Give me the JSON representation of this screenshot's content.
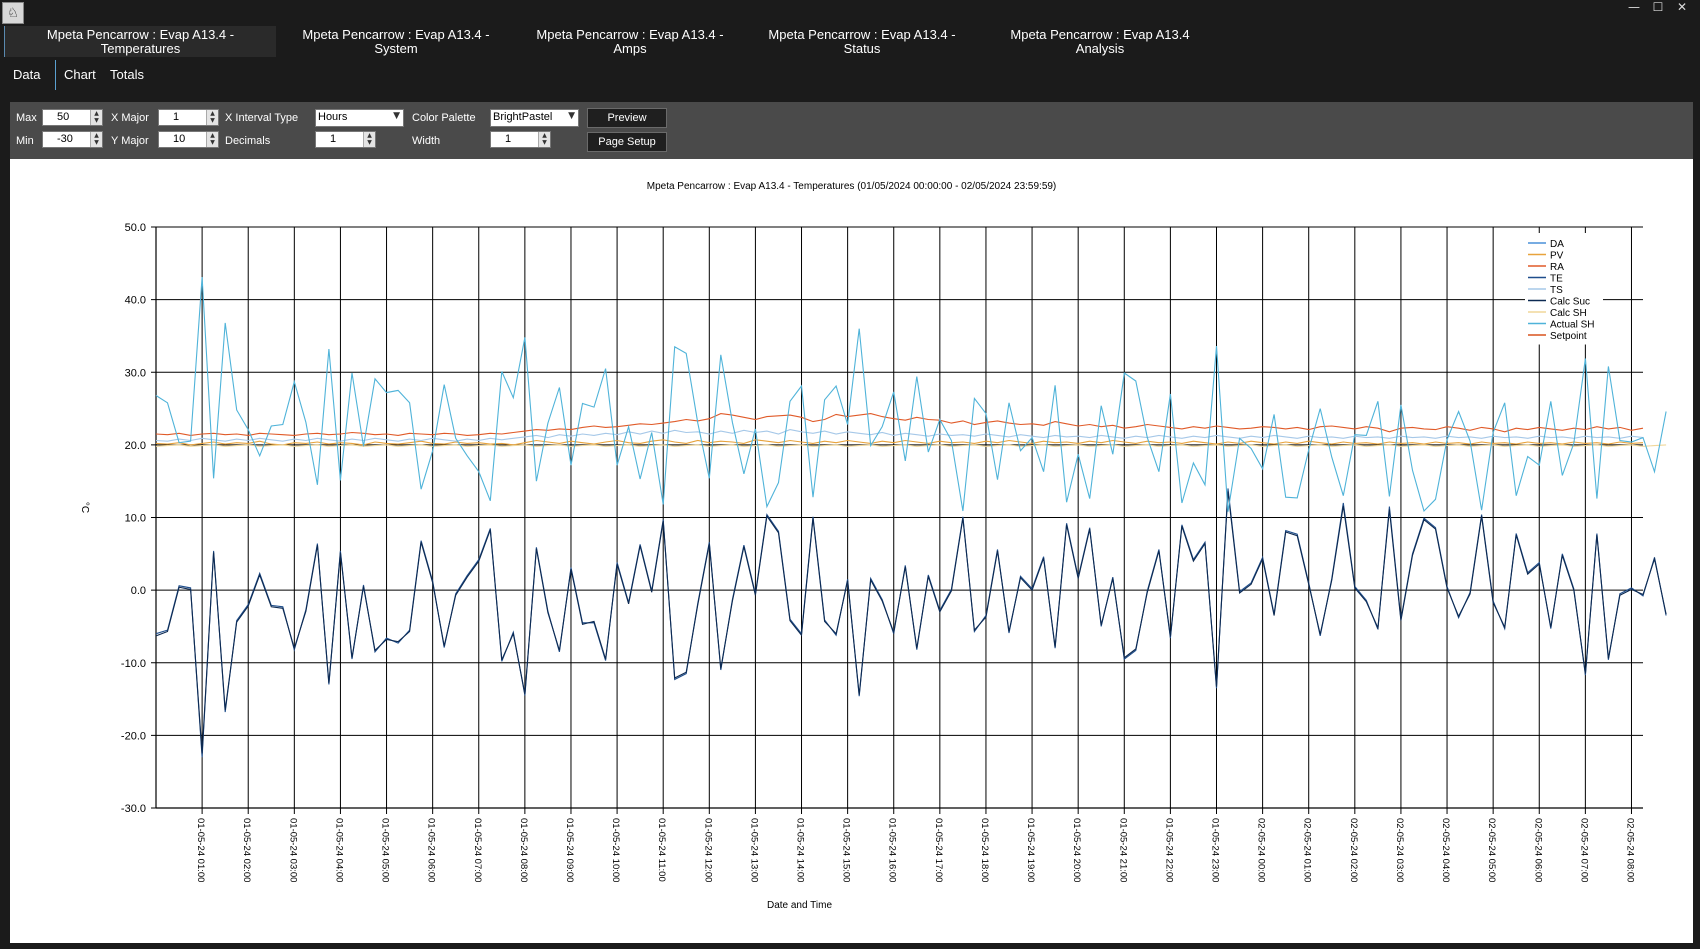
{
  "app": {
    "icon": "app-logo-icon"
  },
  "window_controls": {
    "minimize": "—",
    "maximize": "☐",
    "close": "✕"
  },
  "tabs": [
    {
      "line1": "Mpeta Pencarrow : Evap A13.4 -",
      "line2": "Temperatures",
      "active": true
    },
    {
      "line1": "Mpeta Pencarrow : Evap A13.4 -",
      "line2": "System",
      "active": false
    },
    {
      "line1": "Mpeta Pencarrow : Evap A13.4 -",
      "line2": "Amps",
      "active": false
    },
    {
      "line1": "Mpeta Pencarrow : Evap A13.4 -",
      "line2": "Status",
      "active": false
    },
    {
      "line1": "Mpeta Pencarrow : Evap A13.4",
      "line2": "Analysis",
      "active": false
    }
  ],
  "subtabs": [
    "Data",
    "Chart",
    "Totals"
  ],
  "toolbar": {
    "max_label": "Max",
    "max_value": "50",
    "min_label": "Min",
    "min_value": "-30",
    "xmajor_label": "X Major",
    "xmajor_value": "1",
    "ymajor_label": "Y Major",
    "ymajor_value": "10",
    "xinterval_label": "X Interval Type",
    "xinterval_value": "Hours",
    "decimals_label": "Decimals",
    "decimals_value": "1",
    "palette_label": "Color Palette",
    "palette_value": "BrightPastel",
    "width_label": "Width",
    "width_value": "1",
    "preview_label": "Preview",
    "pagesetup_label": "Page Setup"
  },
  "chart_data": {
    "type": "line",
    "title": "Mpeta Pencarrow : Evap A13.4 - Temperatures (01/05/2024 00:00:00 - 02/05/2024 23:59:59)",
    "xlabel": "Date and Time",
    "ylabel": "°C",
    "ylim": [
      -30,
      50
    ],
    "yticks": [
      "50.0",
      "40.0",
      "30.0",
      "20.0",
      "10.0",
      "0.0",
      "-10.0",
      "-20.0",
      "-30.0"
    ],
    "xlim": [
      0,
      32.25
    ],
    "x_tick_positions": [
      1,
      2,
      3,
      4,
      5,
      6,
      7,
      8,
      9,
      10,
      11,
      12,
      13,
      14,
      15,
      16,
      17,
      18,
      19,
      20,
      21,
      22,
      23,
      24,
      25,
      26,
      27,
      28,
      29,
      30,
      31,
      32
    ],
    "x_tick_labels": [
      "01-05-24 01:00",
      "01-05-24 02:00",
      "01-05-24 03:00",
      "01-05-24 04:00",
      "01-05-24 05:00",
      "01-05-24 06:00",
      "01-05-24 07:00",
      "01-05-24 08:00",
      "01-05-24 09:00",
      "01-05-24 10:00",
      "01-05-24 11:00",
      "01-05-24 12:00",
      "01-05-24 13:00",
      "01-05-24 14:00",
      "01-05-24 15:00",
      "01-05-24 16:00",
      "01-05-24 17:00",
      "01-05-24 18:00",
      "01-05-24 19:00",
      "01-05-24 20:00",
      "01-05-24 21:00",
      "01-05-24 22:00",
      "01-05-24 23:00",
      "02-05-24 00:00",
      "02-05-24 01:00",
      "02-05-24 02:00",
      "02-05-24 03:00",
      "02-05-24 04:00",
      "02-05-24 05:00",
      "02-05-24 06:00",
      "02-05-24 07:00",
      "02-05-24 08:00"
    ],
    "grid": true,
    "legend_position": "top-right",
    "sample_step": 0.25,
    "series": [
      {
        "name": "DA",
        "color": "#4a90d9",
        "values": []
      },
      {
        "name": "PV",
        "color": "#e8a33c",
        "values": [
          20.2,
          20.1,
          20.3,
          20.0,
          20.2,
          20.4,
          20.1,
          20.3,
          20.2,
          20.5,
          20.1,
          20.0,
          20.3,
          20.2,
          20.4,
          20.1,
          20.3,
          20.2,
          20.0,
          20.4,
          20.2,
          20.1,
          20.3,
          20.5,
          20.2,
          20.1,
          20.4,
          20.2,
          20.3,
          20.1,
          20.2,
          20.0,
          20.3,
          20.6,
          20.4,
          20.2,
          20.5,
          20.3,
          20.1,
          20.4,
          20.6,
          20.3,
          20.2,
          20.5,
          20.7,
          20.4,
          20.2,
          20.6,
          20.3,
          20.5,
          20.4,
          20.2,
          20.7,
          20.5,
          20.3,
          20.6,
          20.4,
          20.2,
          20.5,
          20.3,
          20.6,
          20.4,
          20.2,
          20.5,
          20.3,
          20.6,
          20.4,
          20.2,
          20.5,
          20.3,
          20.4,
          20.2,
          20.5,
          20.3,
          20.6,
          20.4,
          20.2,
          20.5,
          20.3,
          20.4,
          20.2,
          20.5,
          20.3,
          20.6,
          20.4,
          20.2,
          20.5,
          20.3,
          20.4,
          20.2,
          20.5,
          20.3,
          20.1,
          20.4,
          20.2,
          20.5,
          20.3,
          20.1,
          20.4,
          20.2,
          20.5,
          20.3,
          20.1,
          20.4,
          20.2,
          20.3,
          20.1,
          20.4,
          20.2,
          20.3,
          20.1,
          20.4,
          20.2,
          20.3,
          20.1,
          20.4,
          20.2,
          20.3,
          20.1,
          20.4,
          20.2,
          20.3,
          20.1,
          20.4,
          20.2,
          20.3,
          20.1,
          20.4,
          20.2,
          20.3
        ]
      },
      {
        "name": "RA",
        "color": "#e05a28",
        "values": [
          21.5,
          21.4,
          21.6,
          21.3,
          21.5,
          21.6,
          21.4,
          21.5,
          21.3,
          21.6,
          21.5,
          21.4,
          21.3,
          21.5,
          21.6,
          21.4,
          21.5,
          21.7,
          21.6,
          21.4,
          21.5,
          21.3,
          21.6,
          21.5,
          21.4,
          21.6,
          21.5,
          21.3,
          21.4,
          21.6,
          21.5,
          21.7,
          21.9,
          22.1,
          22.0,
          22.2,
          22.1,
          22.4,
          22.6,
          22.4,
          22.5,
          22.7,
          22.9,
          22.8,
          23.0,
          23.2,
          23.5,
          23.3,
          23.6,
          24.3,
          24.1,
          23.8,
          23.5,
          23.9,
          24.0,
          24.1,
          23.8,
          23.2,
          23.5,
          24.2,
          23.9,
          24.1,
          24.3,
          23.9,
          23.6,
          23.4,
          23.8,
          23.5,
          23.4,
          23.0,
          23.3,
          22.8,
          23.1,
          23.3,
          23.0,
          22.8,
          22.9,
          22.7,
          23.2,
          22.9,
          22.6,
          22.8,
          22.5,
          22.7,
          22.3,
          22.5,
          22.8,
          22.6,
          22.4,
          22.2,
          22.5,
          22.3,
          22.6,
          22.4,
          22.2,
          22.3,
          22.5,
          22.4,
          22.2,
          22.4,
          22.1,
          22.5,
          22.6,
          22.4,
          22.2,
          22.5,
          22.3,
          21.8,
          22.3,
          22.4,
          22.2,
          22.1,
          22.5,
          22.3,
          22.0,
          22.4,
          22.2,
          21.8,
          22.3,
          22.1,
          22.4,
          22.2,
          22.0,
          22.3,
          22.1,
          22.5,
          22.2,
          22.4,
          22.0,
          22.3
        ]
      },
      {
        "name": "TE",
        "color": "#1f4e8c",
        "values": [
          -6.0,
          -5.5,
          0.6,
          0.3,
          -23.0,
          5.4,
          -16.8,
          -4.2,
          -2.0,
          2.3,
          -2.1,
          -2.3,
          -8.2,
          -2.7,
          6.4,
          -13.0,
          5.4,
          -9.5,
          0.7,
          -8.5,
          -6.6,
          -7.3,
          -5.5,
          6.8,
          1.2,
          -7.9,
          -0.5,
          2.0,
          4.2,
          8.5,
          -9.8,
          -5.8,
          -14.5,
          5.9,
          -2.9,
          -8.5,
          3.1,
          -4.5,
          -4.5,
          -9.7,
          3.8,
          -1.7,
          6.3,
          -0.1,
          9.7,
          -12.3,
          -11.5,
          -1.8,
          6.6,
          -11.0,
          -1.3,
          6.2,
          -0.5,
          10.4,
          8.1,
          -4.0,
          -6.0,
          10.1,
          -4.1,
          -6.2,
          1.5,
          -14.6,
          1.6,
          -1.3,
          -6.0,
          3.4,
          -8.2,
          2.1,
          -2.8,
          0.1,
          10.1,
          -5.7,
          -3.5,
          5.6,
          -5.9,
          1.9,
          0.2,
          4.6,
          -8.0,
          9.2,
          1.8,
          8.6,
          -5.0,
          1.8,
          -9.5,
          -8.3,
          -0.1,
          5.6,
          -6.6,
          9.0,
          4.2,
          6.6,
          -13.5,
          14.0,
          -0.2,
          1.0,
          4.5,
          -3.3,
          8.2,
          7.7,
          1.0,
          -6.3,
          1.6,
          12.0,
          0.5,
          -1.4,
          -5.4,
          11.5,
          -4.0,
          5.0,
          9.9,
          8.6,
          0.5,
          -3.8,
          -0.3,
          10.4,
          -1.5,
          -5.3,
          7.8,
          2.4,
          3.8,
          -5.3,
          5.0,
          0.2,
          -11.7,
          7.8,
          -9.6,
          -0.5,
          0.3,
          -0.8,
          4.5,
          -3.5
        ]
      },
      {
        "name": "TS",
        "color": "#a6c8e8",
        "values": [
          20.6,
          20.5,
          20.8,
          20.6,
          20.9,
          20.7,
          20.5,
          20.8,
          20.6,
          20.9,
          20.7,
          20.5,
          20.8,
          20.6,
          20.9,
          20.7,
          20.5,
          20.8,
          20.6,
          20.9,
          20.7,
          20.5,
          20.8,
          20.6,
          20.9,
          20.7,
          20.5,
          20.8,
          20.6,
          20.9,
          20.7,
          20.9,
          21.1,
          21.3,
          21.0,
          21.4,
          21.2,
          21.5,
          21.3,
          21.6,
          21.4,
          21.8,
          21.5,
          21.9,
          21.6,
          22.0,
          21.7,
          21.8,
          21.5,
          21.9,
          21.6,
          22.0,
          21.7,
          21.9,
          21.5,
          22.1,
          21.8,
          21.6,
          21.9,
          21.5,
          21.8,
          21.6,
          21.4,
          21.7,
          21.3,
          21.6,
          21.4,
          21.2,
          21.5,
          21.3,
          21.4,
          21.2,
          21.5,
          21.3,
          21.1,
          21.4,
          21.2,
          21.0,
          21.3,
          21.1,
          21.2,
          21.0,
          21.3,
          21.1,
          20.9,
          21.2,
          21.0,
          21.3,
          21.1,
          20.9,
          21.2,
          21.0,
          21.3,
          21.1,
          20.9,
          21.2,
          21.0,
          21.3,
          21.1,
          20.9,
          21.2,
          21.0,
          21.1,
          20.9,
          21.2,
          21.0,
          21.1,
          20.9,
          21.2,
          21.0,
          21.1,
          20.9,
          21.2,
          21.0,
          21.1,
          20.9,
          21.2,
          21.0,
          21.1,
          20.9,
          21.2,
          21.0,
          21.1,
          20.9,
          21.2,
          21.0,
          21.1,
          20.9,
          21.2,
          21.0
        ]
      },
      {
        "name": "Calc Suc",
        "color": "#0d2a52",
        "values": [
          -6.3,
          -5.7,
          0.4,
          0.1,
          -22.5,
          5.2,
          -16.5,
          -4.4,
          -2.2,
          2.1,
          -2.3,
          -2.5,
          -8.0,
          -2.9,
          6.2,
          -12.8,
          5.2,
          -9.3,
          0.5,
          -8.3,
          -6.8,
          -7.1,
          -5.7,
          6.6,
          1.0,
          -7.7,
          -0.7,
          1.8,
          4.0,
          8.3,
          -9.6,
          -6.0,
          -14.3,
          5.7,
          -3.1,
          -8.3,
          2.9,
          -4.7,
          -4.3,
          -9.5,
          3.6,
          -1.9,
          6.1,
          -0.3,
          9.5,
          -12.1,
          -11.3,
          -2.0,
          6.4,
          -10.8,
          -1.5,
          6.0,
          -0.7,
          10.2,
          7.9,
          -4.2,
          -6.2,
          9.9,
          -4.3,
          -6.0,
          1.3,
          -14.4,
          1.4,
          -1.5,
          -5.8,
          3.2,
          -8.0,
          1.9,
          -3.0,
          -0.1,
          9.9,
          -5.5,
          -3.7,
          5.4,
          -5.7,
          1.7,
          0.0,
          4.4,
          -7.8,
          9.0,
          1.6,
          8.4,
          -4.8,
          1.6,
          -9.3,
          -8.1,
          -0.3,
          5.4,
          -6.4,
          8.8,
          4.0,
          6.4,
          -13.3,
          13.6,
          -0.4,
          0.8,
          4.3,
          -3.5,
          8.0,
          7.5,
          0.8,
          -6.1,
          1.4,
          11.6,
          0.3,
          -1.6,
          -5.2,
          11.1,
          -4.2,
          4.8,
          9.7,
          8.4,
          0.3,
          -3.6,
          -0.5,
          10.2,
          -1.7,
          -5.1,
          7.6,
          2.2,
          3.6,
          -5.1,
          4.8,
          0.0,
          -11.5,
          7.6,
          -9.4,
          -0.7,
          0.1,
          -0.6,
          4.3,
          -3.3
        ]
      },
      {
        "name": "Calc SH",
        "color": "#f0d79a",
        "values": [
          19.8,
          19.9,
          20.0,
          19.8,
          19.9,
          20.0,
          19.8,
          19.9,
          20.0,
          19.8,
          19.9,
          20.0,
          19.8,
          19.9,
          20.0,
          19.8,
          19.9,
          20.0,
          19.8,
          19.9,
          20.0,
          19.8,
          19.9,
          20.0,
          19.8,
          19.9,
          20.0,
          19.8,
          19.9,
          20.0,
          19.8,
          19.9,
          20.0,
          19.8,
          19.9,
          20.0,
          19.8,
          19.9,
          20.0,
          19.8,
          19.9,
          20.0,
          19.8,
          19.9,
          20.0,
          19.8,
          19.9,
          20.0,
          19.8,
          19.9,
          20.0,
          19.8,
          19.9,
          20.0,
          19.8,
          19.9,
          20.0,
          19.8,
          19.9,
          20.0,
          19.8,
          19.9,
          20.0,
          19.8,
          19.9,
          20.0,
          19.8,
          19.9,
          20.0,
          19.8,
          19.9,
          20.0,
          19.8,
          19.9,
          20.0,
          19.8,
          19.9,
          20.0,
          19.8,
          19.9,
          20.0,
          19.8,
          19.9,
          20.0,
          19.8,
          19.9,
          20.0,
          19.8,
          19.9,
          20.0,
          19.8,
          19.9,
          20.0,
          19.8,
          19.9,
          20.0,
          19.8,
          19.9,
          20.0,
          19.8,
          19.9,
          20.0,
          19.8,
          19.9,
          20.0,
          19.8,
          19.9,
          20.0,
          19.8,
          19.9,
          20.0,
          19.8,
          19.9,
          20.0,
          19.8,
          19.9,
          20.0,
          19.8,
          19.9,
          20.0,
          19.8,
          19.9,
          20.0,
          19.8,
          19.9,
          20.0,
          19.8,
          19.9,
          20.0,
          19.8,
          19.9,
          20.0
        ]
      },
      {
        "name": "Actual SH",
        "color": "#4fb3d9",
        "values": [
          26.8,
          25.8,
          20.3,
          20.5,
          43.1,
          15.4,
          36.8,
          24.8,
          22.1,
          18.5,
          22.6,
          22.8,
          28.7,
          23.1,
          14.5,
          33.2,
          15.1,
          29.9,
          19.8,
          29.1,
          27.2,
          27.5,
          25.8,
          13.9,
          19.2,
          28.3,
          20.9,
          18.5,
          16.3,
          12.3,
          30.1,
          26.5,
          34.8,
          15.0,
          23.0,
          27.9,
          17.2,
          25.7,
          25.2,
          30.5,
          17.2,
          22.5,
          15.3,
          21.7,
          11.8,
          33.5,
          32.6,
          23.0,
          15.4,
          32.4,
          23.1,
          16.0,
          22.2,
          11.5,
          14.8,
          26.0,
          28.1,
          12.8,
          26.2,
          28.1,
          22.8,
          36.0,
          19.9,
          22.5,
          27.3,
          17.8,
          29.4,
          19.0,
          23.5,
          20.6,
          10.9,
          26.4,
          24.3,
          15.2,
          25.8,
          19.2,
          21.0,
          16.3,
          28.2,
          12.1,
          18.7,
          12.6,
          25.4,
          18.7,
          29.9,
          28.8,
          21.0,
          16.3,
          27.0,
          12.0,
          17.5,
          14.5,
          33.6,
          10.8,
          20.9,
          19.5,
          16.7,
          24.2,
          12.8,
          12.7,
          19.3,
          25.0,
          18.3,
          13.0,
          21.4,
          21.3,
          26.0,
          12.9,
          25.5,
          16.5,
          10.9,
          12.5,
          20.7,
          24.6,
          20.5,
          11.0,
          21.7,
          25.8,
          13.0,
          18.4,
          17.2,
          26.0,
          15.8,
          20.2,
          31.9,
          12.6,
          30.8,
          20.6,
          20.4,
          21.0,
          16.3,
          24.6
        ]
      },
      {
        "name": "Setpoint",
        "color": "#d9531e",
        "values": []
      }
    ]
  }
}
